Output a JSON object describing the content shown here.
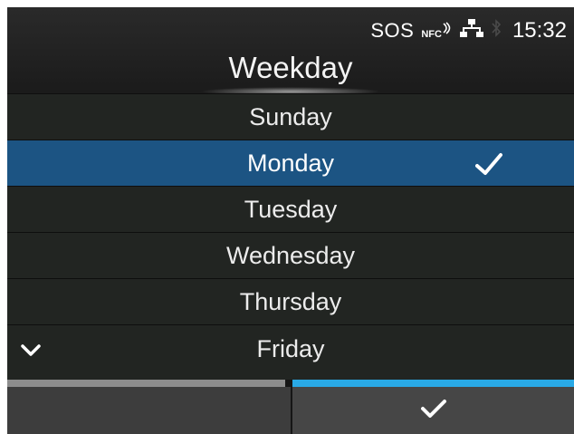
{
  "status_bar": {
    "sos_label": "SOS",
    "nfc_label": "NFC",
    "icons": [
      "nfc-icon",
      "network-icon",
      "bluetooth-icon"
    ],
    "time": "15:32"
  },
  "header": {
    "title": "Weekday"
  },
  "list": {
    "items": [
      {
        "label": "Sunday"
      },
      {
        "label": "Monday"
      },
      {
        "label": "Tuesday"
      },
      {
        "label": "Wednesday"
      },
      {
        "label": "Thursday"
      },
      {
        "label": "Friday"
      }
    ],
    "selected_index": 1
  },
  "softkeys": {
    "left_icon": "",
    "right_icon": "checkmark-icon"
  },
  "colors": {
    "background": "#161616",
    "row": "#222522",
    "selected": "#1c5483",
    "accent": "#29a9e6",
    "softkey_indicator_left": "#8d8d8d"
  }
}
